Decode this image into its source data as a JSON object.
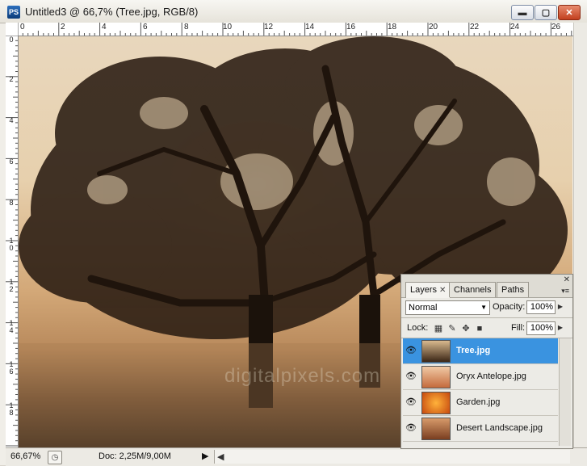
{
  "window": {
    "app_icon": "PS",
    "title": "Untitled3 @ 66,7% (Tree.jpg, RGB/8)",
    "minimize": "▬",
    "maximize": "▢",
    "close": "✕"
  },
  "rulers": {
    "top_ticks": [
      "0",
      "2",
      "4",
      "6",
      "8",
      "10",
      "12",
      "14",
      "16",
      "18",
      "20",
      "22",
      "24",
      "26"
    ],
    "left_ticks": [
      "0",
      "2",
      "4",
      "6",
      "8",
      "1 0",
      "1 2",
      "1 4",
      "1 6",
      "1 8"
    ]
  },
  "canvas": {
    "watermark": "digitalpixels.com"
  },
  "status": {
    "zoom": "66,67%",
    "doc": "Doc: 2,25M/9,00M",
    "arrow": "▶",
    "scroll_left": "◀"
  },
  "layers_panel": {
    "tabs": [
      {
        "label": "Layers",
        "close": "✕"
      },
      {
        "label": "Channels"
      },
      {
        "label": "Paths"
      }
    ],
    "panel_close": "✕",
    "panel_menu": "▾≡",
    "blend_mode": "Normal",
    "opacity_label": "Opacity:",
    "opacity_value": "100%",
    "lock_label": "Lock:",
    "fill_label": "Fill:",
    "fill_value": "100%",
    "layers": [
      {
        "name": "Tree.jpg",
        "selected": true
      },
      {
        "name": "Oryx Antelope.jpg",
        "selected": false
      },
      {
        "name": "Garden.jpg",
        "selected": false
      },
      {
        "name": "Desert Landscape.jpg",
        "selected": false
      }
    ]
  }
}
